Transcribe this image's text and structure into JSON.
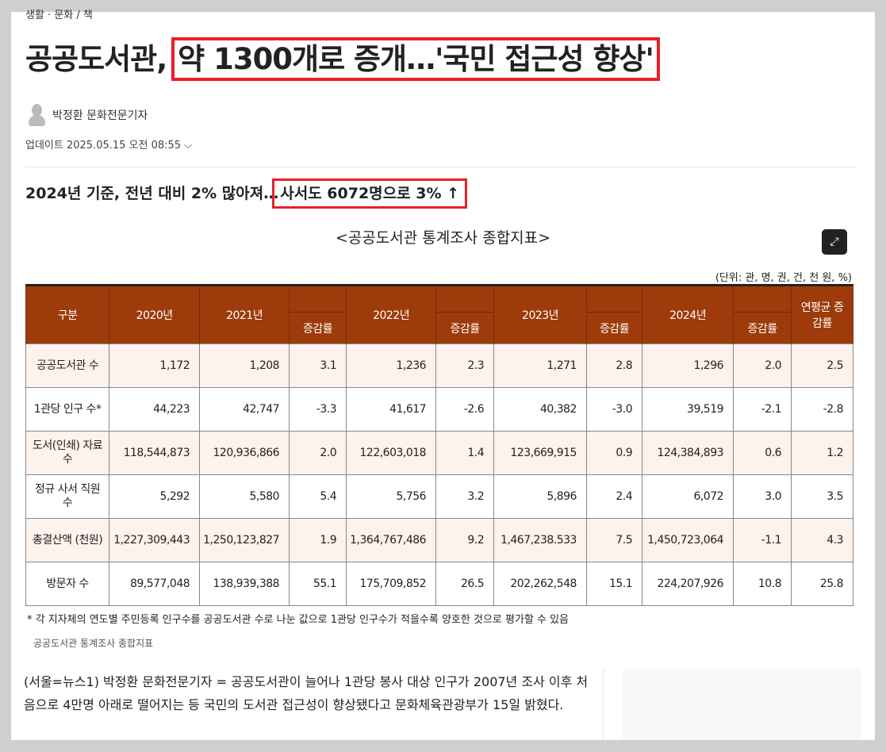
{
  "breadcrumb": "생활 · 문화  /  책",
  "headline": {
    "prefix": "공공도서관,",
    "highlight": "약 1300개로 증개…'국민 접근성 향상'"
  },
  "author": "박정환 문화전문기자",
  "updated": "업데이트 2025.05.15 오전 08:55",
  "subtitle": {
    "prefix": "2024년 기준, 전년 대비 2% 많아져…",
    "highlight": "사서도 6072명으로 3% ↑"
  },
  "table": {
    "title": "<공공도서관 통계조사 종합지표>",
    "unit": "(단위: 관, 명, 권, 건, 천 원, %)",
    "headers": {
      "category": "구분",
      "y2020": "2020년",
      "y2021": "2021년",
      "y2022": "2022년",
      "y2023": "2023년",
      "y2024": "2024년",
      "rate": "증감률",
      "avg": "연평균 증감률"
    },
    "rows": [
      {
        "label": "공공도서관 수",
        "values": [
          "1,172",
          "1,208",
          "3.1",
          "1,236",
          "2.3",
          "1,271",
          "2.8",
          "1,296",
          "2.0",
          "2.5"
        ]
      },
      {
        "label": "1관당 인구 수*",
        "values": [
          "44,223",
          "42,747",
          "-3.3",
          "41,617",
          "-2.6",
          "40,382",
          "-3.0",
          "39,519",
          "-2.1",
          "-2.8"
        ]
      },
      {
        "label": "도서(인쇄) 자료 수",
        "values": [
          "118,544,873",
          "120,936,866",
          "2.0",
          "122,603,018",
          "1.4",
          "123,669,915",
          "0.9",
          "124,384,893",
          "0.6",
          "1.2"
        ]
      },
      {
        "label": "정규 사서 직원 수",
        "values": [
          "5,292",
          "5,580",
          "5.4",
          "5,756",
          "3.2",
          "5,896",
          "2.4",
          "6,072",
          "3.0",
          "3.5"
        ]
      },
      {
        "label": "총결산액 (천원)",
        "values": [
          "1,227,309,443",
          "1,250,123,827",
          "1.9",
          "1,364,767,486",
          "9.2",
          "1,467,238.533",
          "7.5",
          "1,450,723,064",
          "-1.1",
          "4.3"
        ]
      },
      {
        "label": "방문자 수",
        "values": [
          "89,577,048",
          "138,939,388",
          "55.1",
          "175,709,852",
          "26.5",
          "202,262,548",
          "15.1",
          "224,207,926",
          "10.8",
          "25.8"
        ]
      }
    ],
    "note": "* 각 지자체의 연도별 주민등록 인구수를 공공도서관 수로 나눈 값으로 1관당 인구수가 적을수록 양호한 것으로 평가할 수 있음",
    "caption": "공공도서관 통계조사 종합지표"
  },
  "body": "(서울=뉴스1) 박정환 문화전문기자 = 공공도서관이 늘어나 1관당 봉사 대상 인구가 2007년 조사 이후 처음으로 4만명 아래로 떨어지는 등 국민의 도서관 접근성이 향상됐다고 문화체육관광부가 15일 밝혔다.",
  "colors": {
    "header": "#9e3b0a",
    "row_tint": "#fdf2ec",
    "highlight_box": "#e8202a"
  }
}
